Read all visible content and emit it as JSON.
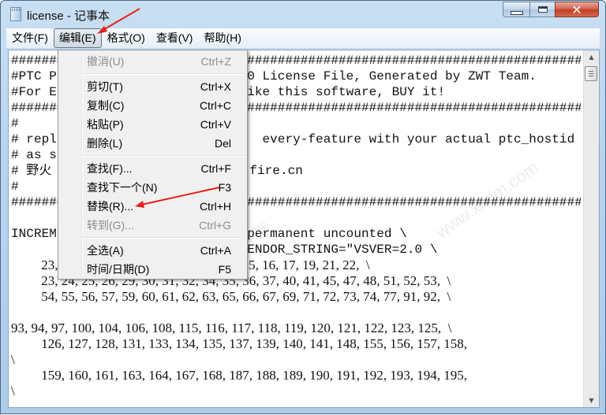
{
  "window": {
    "title": "license - 记事本",
    "controls": {
      "minimize": "minimize",
      "maximize": "maximize",
      "close": "✕"
    }
  },
  "menubar": {
    "items": [
      {
        "label": "文件(F)",
        "active": false
      },
      {
        "label": "编辑(E)",
        "active": true
      },
      {
        "label": "格式(O)",
        "active": false
      },
      {
        "label": "查看(V)",
        "active": false
      },
      {
        "label": "帮助(H)",
        "active": false
      }
    ]
  },
  "edit_menu": {
    "items": [
      {
        "label": "撤消(U)",
        "shortcut": "Ctrl+Z",
        "disabled": true
      },
      {
        "separator": true
      },
      {
        "label": "剪切(T)",
        "shortcut": "Ctrl+X",
        "disabled": false
      },
      {
        "label": "复制(C)",
        "shortcut": "Ctrl+C",
        "disabled": false
      },
      {
        "label": "粘贴(P)",
        "shortcut": "Ctrl+V",
        "disabled": false
      },
      {
        "label": "删除(L)",
        "shortcut": "Del",
        "disabled": false
      },
      {
        "separator": true
      },
      {
        "label": "查找(F)...",
        "shortcut": "Ctrl+F",
        "disabled": false
      },
      {
        "label": "查找下一个(N)",
        "shortcut": "F3",
        "disabled": false
      },
      {
        "label": "替换(R)...",
        "shortcut": "Ctrl+H",
        "disabled": false
      },
      {
        "label": "转到(G)...",
        "shortcut": "Ctrl+G",
        "disabled": true
      },
      {
        "separator": true
      },
      {
        "label": "全选(A)",
        "shortcut": "Ctrl+A",
        "disabled": false
      },
      {
        "label": "时间/日期(D)",
        "shortcut": "F5",
        "disabled": false
      }
    ]
  },
  "document": {
    "lines": [
      {
        "text": "#############################################################################",
        "style": "mono"
      },
      {
        "text": "#PTC P                         0 License File, Generated by ZWT Team.",
        "style": "mono"
      },
      {
        "text": "#For E                         ike this software, BUY it!",
        "style": "mono"
      },
      {
        "text": "#############################################################################",
        "style": "mono"
      },
      {
        "text": "#",
        "style": "mono"
      },
      {
        "text": "# repl                           every-feature with your actual ptc_hostid",
        "style": "mono"
      },
      {
        "text": "# as s",
        "style": "mono"
      },
      {
        "text": "# 野火                          fire.cn",
        "style": "mono"
      },
      {
        "text": "#",
        "style": "mono"
      },
      {
        "text": "#############################################################################",
        "style": "mono"
      },
      {
        "text": "",
        "style": "mono"
      },
      {
        "text": "INCREM                         permanent uncounted \\",
        "style": "mono"
      },
      {
        "text": "                               ENDOR_STRING=\"VSVER=2.0 \\",
        "style": "mono"
      },
      {
        "text": "         23, 24, 25, 26, 27, 28, 11, 12, 13, 14, 15, 16, 17, 19, 21, 22,  \\",
        "style": "serifnum"
      },
      {
        "text": "         23, 24, 25, 26, 29, 30, 31, 32, 34, 35, 36, 37, 40, 41, 45, 47, 48, 51, 52, 53,  \\",
        "style": "serifnum"
      },
      {
        "text": "         54, 55, 56, 57, 59, 60, 61, 62, 63, 65, 66, 67, 69, 71, 72, 73, 74, 77, 91, 92,  \\",
        "style": "serifnum"
      },
      {
        "text": "",
        "style": "serifnum"
      },
      {
        "text": "93, 94, 97, 100, 104, 106, 108, 115, 116, 117, 118, 119, 120, 121, 122, 123, 125,  \\",
        "style": "serifnum"
      },
      {
        "text": "         126, 127, 128, 131, 133, 134, 135, 137, 139, 140, 141, 148, 155, 156, 157, 158,",
        "style": "serifnum"
      },
      {
        "text": "\\",
        "style": "serifnum"
      },
      {
        "text": "         159, 160, 161, 163, 164, 167, 168, 187, 188, 189, 190, 191, 192, 193, 194, 195,",
        "style": "serifnum"
      },
      {
        "text": "\\",
        "style": "serifnum"
      }
    ]
  },
  "scrollbar": {
    "up_arrow": "▲",
    "down_arrow": "▼",
    "position": 0.0
  },
  "watermarks": [
    "www.xxrjm.com",
    "www.xxrjm.com",
    "小小软件迷",
    "小小软件迷"
  ],
  "annotations": {
    "arrow_color": "#e8201a"
  }
}
